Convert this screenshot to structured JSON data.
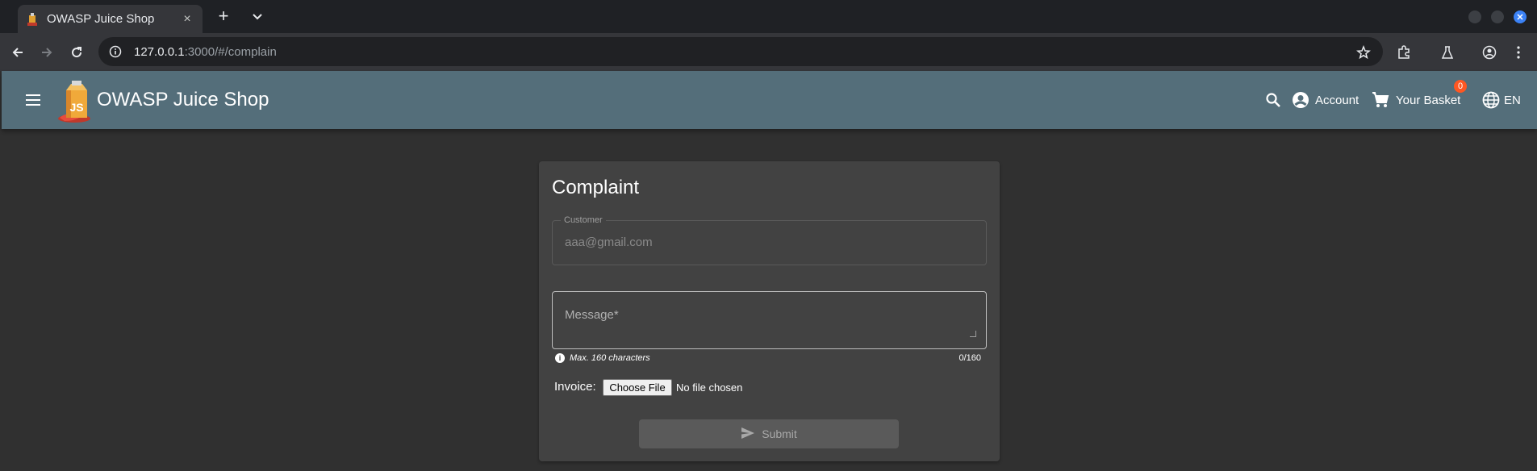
{
  "browser": {
    "tab_title": "OWASP Juice Shop",
    "tab_close": "×",
    "new_tab": "+",
    "url_host": "127.0.0.1",
    "url_rest": ":3000/#/complain"
  },
  "header": {
    "brand": "OWASP Juice Shop",
    "account_label": "Account",
    "basket_label": "Your Basket",
    "basket_count": "0",
    "language_label": "EN"
  },
  "complaint": {
    "title": "Complaint",
    "customer_label": "Customer",
    "customer_value": "aaa@gmail.com",
    "message_placeholder": "Message*",
    "hint": "Max. 160 characters",
    "counter": "0/160",
    "invoice_label": "Invoice:",
    "choose_file": "Choose File",
    "no_file": "No file chosen",
    "submit_label": "Submit"
  },
  "colors": {
    "appbar": "#546e7a",
    "background": "#303030",
    "card": "#424242",
    "badge": "#ff5722"
  }
}
